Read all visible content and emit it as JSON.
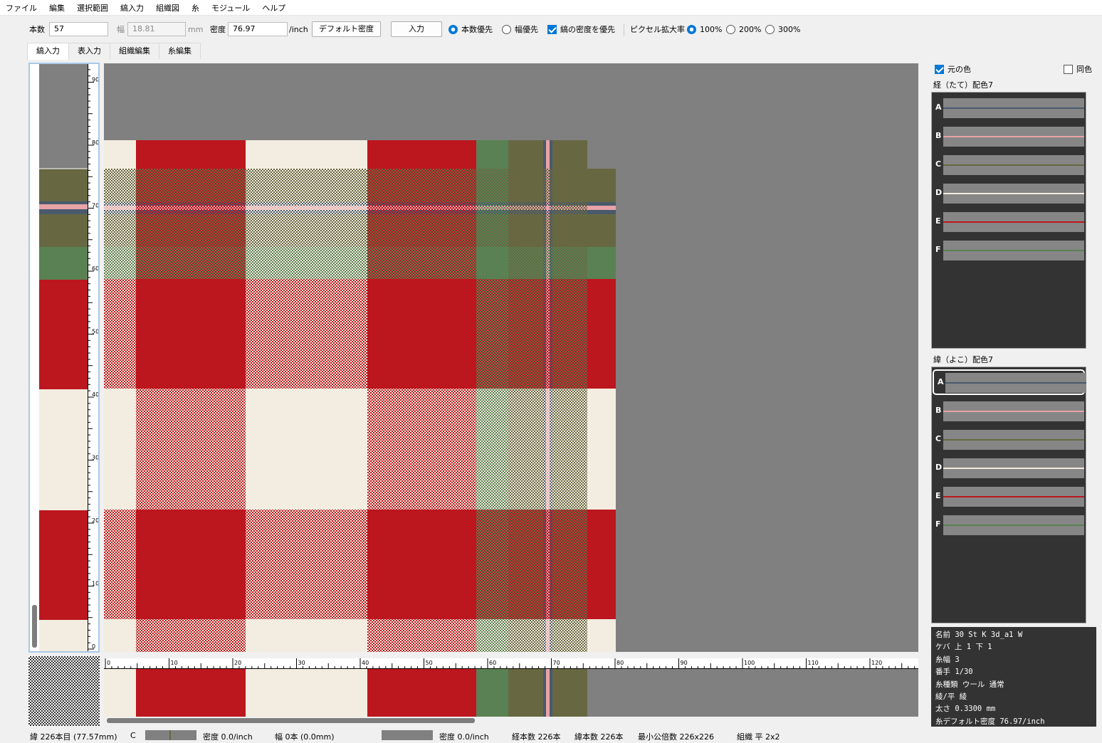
{
  "menu": [
    "ファイル",
    "編集",
    "選択範囲",
    "縞入力",
    "組織図",
    "糸",
    "モジュール",
    "ヘルプ"
  ],
  "toolbar": {
    "count_label": "本数",
    "count_value": "57",
    "width_label": "幅",
    "width_value": "18.81",
    "width_unit": "mm",
    "density_label": "密度",
    "density_value": "76.97",
    "density_unit": "/inch",
    "default_density_button": "デフォルト密度",
    "input_button": "入力",
    "radio_count_priority": "本数優先",
    "radio_width_priority": "幅優先",
    "check_stripe_density": "縞の密度を優先",
    "zoom_label": "ピクセル拡大率",
    "zoom_options": [
      "100%",
      "200%",
      "300%"
    ],
    "zoom_selected": "100%"
  },
  "tabs": [
    "縞入力",
    "表入力",
    "組織編集",
    "糸編集"
  ],
  "active_tab": "縞入力",
  "vertical_ruler_labels": [
    "90",
    "80",
    "70",
    "60",
    "50",
    "40",
    "30",
    "20",
    "10",
    "0"
  ],
  "horizontal_ruler_labels": [
    "0",
    "10",
    "20",
    "30",
    "40",
    "50",
    "60",
    "70",
    "80",
    "90",
    "100",
    "110",
    "120"
  ],
  "colors": {
    "A": "#4a5a6c",
    "B": "#e8a3a7",
    "C": "#676842",
    "D": "#f3ece0",
    "E": "#bc161e",
    "F": "#5a8153",
    "empty": "#808080"
  },
  "right_panel": {
    "original_color_label": "元の色",
    "original_color_checked": true,
    "same_color_label": "同色",
    "same_color_checked": false,
    "warp_header": "経（たて）配色7",
    "weft_header": "緯（よこ）配色7",
    "warp_yarns": [
      "A",
      "B",
      "C",
      "D",
      "E",
      "F"
    ],
    "weft_yarns": [
      "A",
      "B",
      "C",
      "D",
      "E",
      "F"
    ],
    "weft_selected": "A"
  },
  "yarn_info": [
    "名前  30 St K 3d_a1 W",
    "ケバ  上 1 下 1",
    "糸幅  3",
    "番手  1/30",
    "糸種類  ウール  通常",
    "綾/平  綾",
    "太さ  0.3300 mm",
    "糸デフォルト密度  76.97/inch"
  ],
  "status": {
    "position": "緯 226本目 (77.57mm)",
    "yarn": "C",
    "density1": "密度 0.0/inch",
    "width": "幅 0本 (0.0mm)",
    "density2": "密度 0.0/inch",
    "warp_count": "経本数 226本",
    "weft_count": "緯本数 226本",
    "lcm": "最小公倍数 226x226",
    "weave": "組織 平 2x2"
  }
}
